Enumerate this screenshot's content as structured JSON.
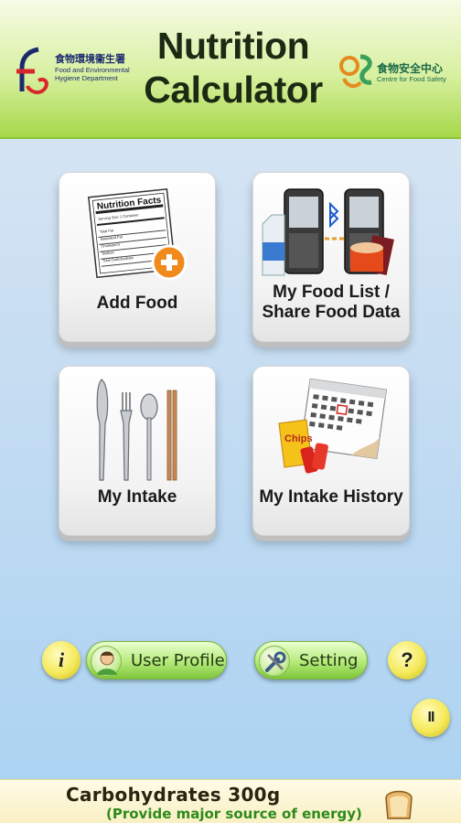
{
  "header": {
    "title_line1": "Nutrition",
    "title_line2": "Calculator",
    "fehd_logo": {
      "zh": "食物環境衞生署",
      "en": "Food and Environmental Hygiene Department",
      "icon": "fehd-logo-icon"
    },
    "cfs_logo": {
      "zh": "食物安全中心",
      "en": "Centre for Food Safety",
      "icon": "cfs-logo-icon"
    }
  },
  "tiles": [
    {
      "label": "Add Food",
      "icon": "nutrition-label-add-icon"
    },
    {
      "label_line1": "My Food List /",
      "label_line2": "Share Food Data",
      "icon": "phones-bluetooth-icon"
    },
    {
      "label": "My Intake",
      "icon": "cutlery-icon"
    },
    {
      "label": "My Intake History",
      "icon": "calendar-snacks-icon"
    }
  ],
  "nutrition_card": {
    "title": "Nutrition Facts",
    "lines": [
      "Serving Size 1 Container",
      "Servings Per Container 4",
      "Total Fat",
      "Saturated Fat",
      "Trans Fat",
      "Cholesterol",
      "Sodium",
      "Total Carbohydrate",
      "Dietary Fiber"
    ]
  },
  "toolbar": {
    "info_label": "i",
    "user_profile_label": "User Profile",
    "setting_label": "Setting",
    "help_label": "?",
    "pause_label": "II"
  },
  "footer": {
    "main": "Carbohydrates 300g",
    "sub": "(Provide major source of energy)",
    "icon": "bread-icon"
  },
  "snack_bag_label": "Chips",
  "colors": {
    "header_green": "#a6d84a",
    "background_blue": "#c9def2",
    "button_yellow": "#f5ea5a",
    "pill_green": "#b5ea7a",
    "footer_green_text": "#2c8a1a"
  }
}
